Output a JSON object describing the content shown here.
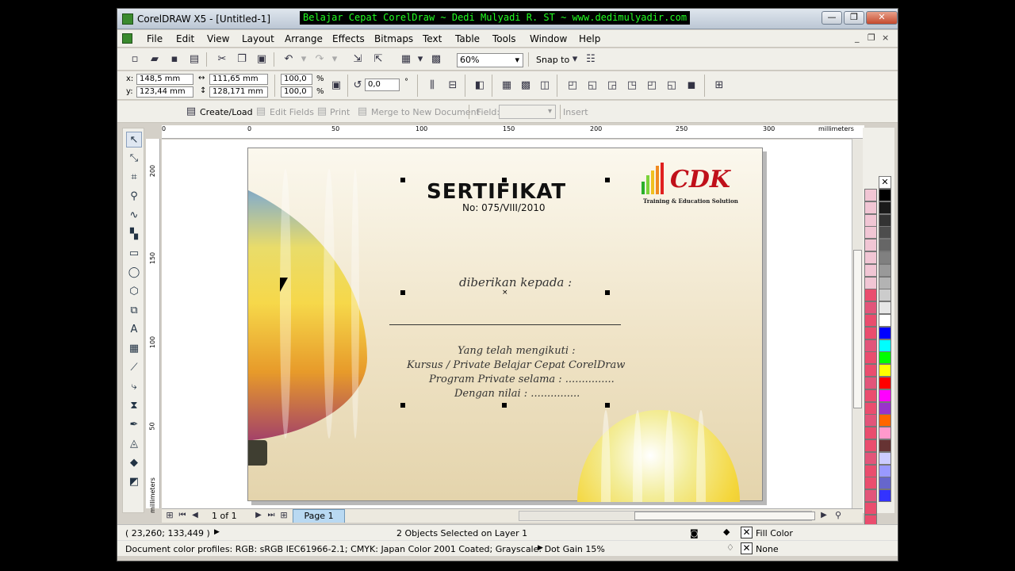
{
  "window": {
    "title": "CorelDRAW X5 - [Untitled-1]",
    "caption_buttons": [
      "—",
      "❐",
      "✕"
    ]
  },
  "overlay": {
    "text": "Belajar Cepat CorelDraw ~ Dedi Mulyadi R. ST ~ www.dedimulyadir.com"
  },
  "menu": [
    "File",
    "Edit",
    "View",
    "Layout",
    "Arrange",
    "Effects",
    "Bitmaps",
    "Text",
    "Table",
    "Tools",
    "Window",
    "Help"
  ],
  "doc_controls": [
    "_",
    "❐",
    "×"
  ],
  "standard_toolbar": {
    "zoom": "60%",
    "snap_to": "Snap to"
  },
  "property_bar": {
    "x_label": "x:",
    "x": "148,5 mm",
    "y_label": "y:",
    "y": "123,44 mm",
    "width": "111,65 mm",
    "height": "128,171 mm",
    "scale_x": "100,0",
    "scale_y": "100,0",
    "percent": "%",
    "angle": "0,0",
    "degree": "°"
  },
  "merge_toolbar": {
    "create_load": "Create/Load",
    "edit_fields": "Edit Fields",
    "print": "Print",
    "merge": "Merge to New Document",
    "field_label": "Field:",
    "insert": "Insert"
  },
  "ruler": {
    "h_ticks": [
      "0",
      "0",
      "50",
      "100",
      "150",
      "200",
      "250",
      "300"
    ],
    "h_units": "millimeters",
    "v_ticks": [
      "200",
      "150",
      "100",
      "50"
    ],
    "v_units": "millimeters"
  },
  "certificate": {
    "title": "SERTIFIKAT",
    "number": "No: 075/VIII/2010",
    "logo_text": "CDK",
    "logo_sub": "Training & Education Solution",
    "given_to": "diberikan  kepada  :",
    "lines": [
      "Yang  telah  mengikuti  :",
      "Kursus  /  Private  Belajar  Cepat  CorelDraw",
      "Program  Private  selama  :  ...............",
      "Dengan  nilai  :  ..............."
    ]
  },
  "page_nav": {
    "count": "1 of 1",
    "tab": "Page 1"
  },
  "status": {
    "coords": "( 23,260; 133,449 )",
    "selection": "2 Objects Selected on Layer 1",
    "fill": "Fill Color",
    "outline": "None",
    "profiles": "Document color profiles: RGB: sRGB IEC61966-2.1; CMYK: Japan Color 2001 Coated; Grayscale: Dot Gain 15%"
  },
  "palette_colors": [
    "#000000",
    "#1a1a1a",
    "#333333",
    "#4d4d4d",
    "#666666",
    "#808080",
    "#999999",
    "#b3b3b3",
    "#cccccc",
    "#e6e6e6",
    "#ffffff",
    "#0000ff",
    "#00ffff",
    "#00ff00",
    "#ffff00",
    "#ff0000",
    "#ff00ff",
    "#9933cc",
    "#ff6600",
    "#ff99cc",
    "#663333",
    "#ccccff",
    "#9999ff",
    "#6666cc",
    "#3333ff"
  ]
}
